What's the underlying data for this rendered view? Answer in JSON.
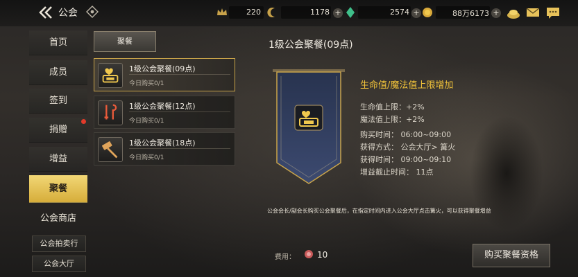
{
  "header": {
    "title": "公会",
    "resources": [
      {
        "value": "220",
        "icon": "gold-crown-icon"
      },
      {
        "value": "1178",
        "icon": "crescent-coin-icon"
      },
      {
        "value": "2574",
        "icon": "green-gem-icon"
      },
      {
        "value": "88万6173",
        "icon": "gold-coin-icon"
      }
    ],
    "right_icons": [
      "treasure-pot-icon",
      "mail-icon",
      "chat-icon"
    ]
  },
  "sidebar": {
    "items": [
      {
        "label": "首页"
      },
      {
        "label": "成员"
      },
      {
        "label": "签到"
      },
      {
        "label": "捐赠",
        "notification": true
      },
      {
        "label": "增益"
      },
      {
        "label": "聚餐",
        "active": true
      },
      {
        "label": "公会商店"
      },
      {
        "label": "公会拍卖行"
      },
      {
        "label": "公会大厅"
      }
    ]
  },
  "tab": {
    "label": "聚餐"
  },
  "list": [
    {
      "title": "1级公会聚餐(09点)",
      "sub": "今日购买0/1",
      "selected": true
    },
    {
      "title": "1级公会聚餐(12点)",
      "sub": "今日购买0/1"
    },
    {
      "title": "1级公会聚餐(18点)",
      "sub": "今日购买0/1"
    }
  ],
  "detail": {
    "title": "1级公会聚餐(09点)",
    "feature": "生命值/魔法值上限增加",
    "lines": [
      "生命值上限：+2%",
      "魔法值上限：+2%",
      "购买时间：  06:00~09:00",
      "获得方式：  公会大厅> 篝火",
      "获得时间：  09:00~09:10",
      "增益截止时间：  11点"
    ],
    "description": "公会会长/副会长购买公会聚餐后，在指定时间内进入公会大厅点击篝火，可以获得聚餐增益",
    "cost_label": "费用：",
    "cost_value": "10",
    "buy_label": "购买聚餐资格"
  },
  "colors": {
    "accent": "#f0c23a",
    "active_tab": "#e3c25a",
    "red_dot": "#e23a2a"
  }
}
